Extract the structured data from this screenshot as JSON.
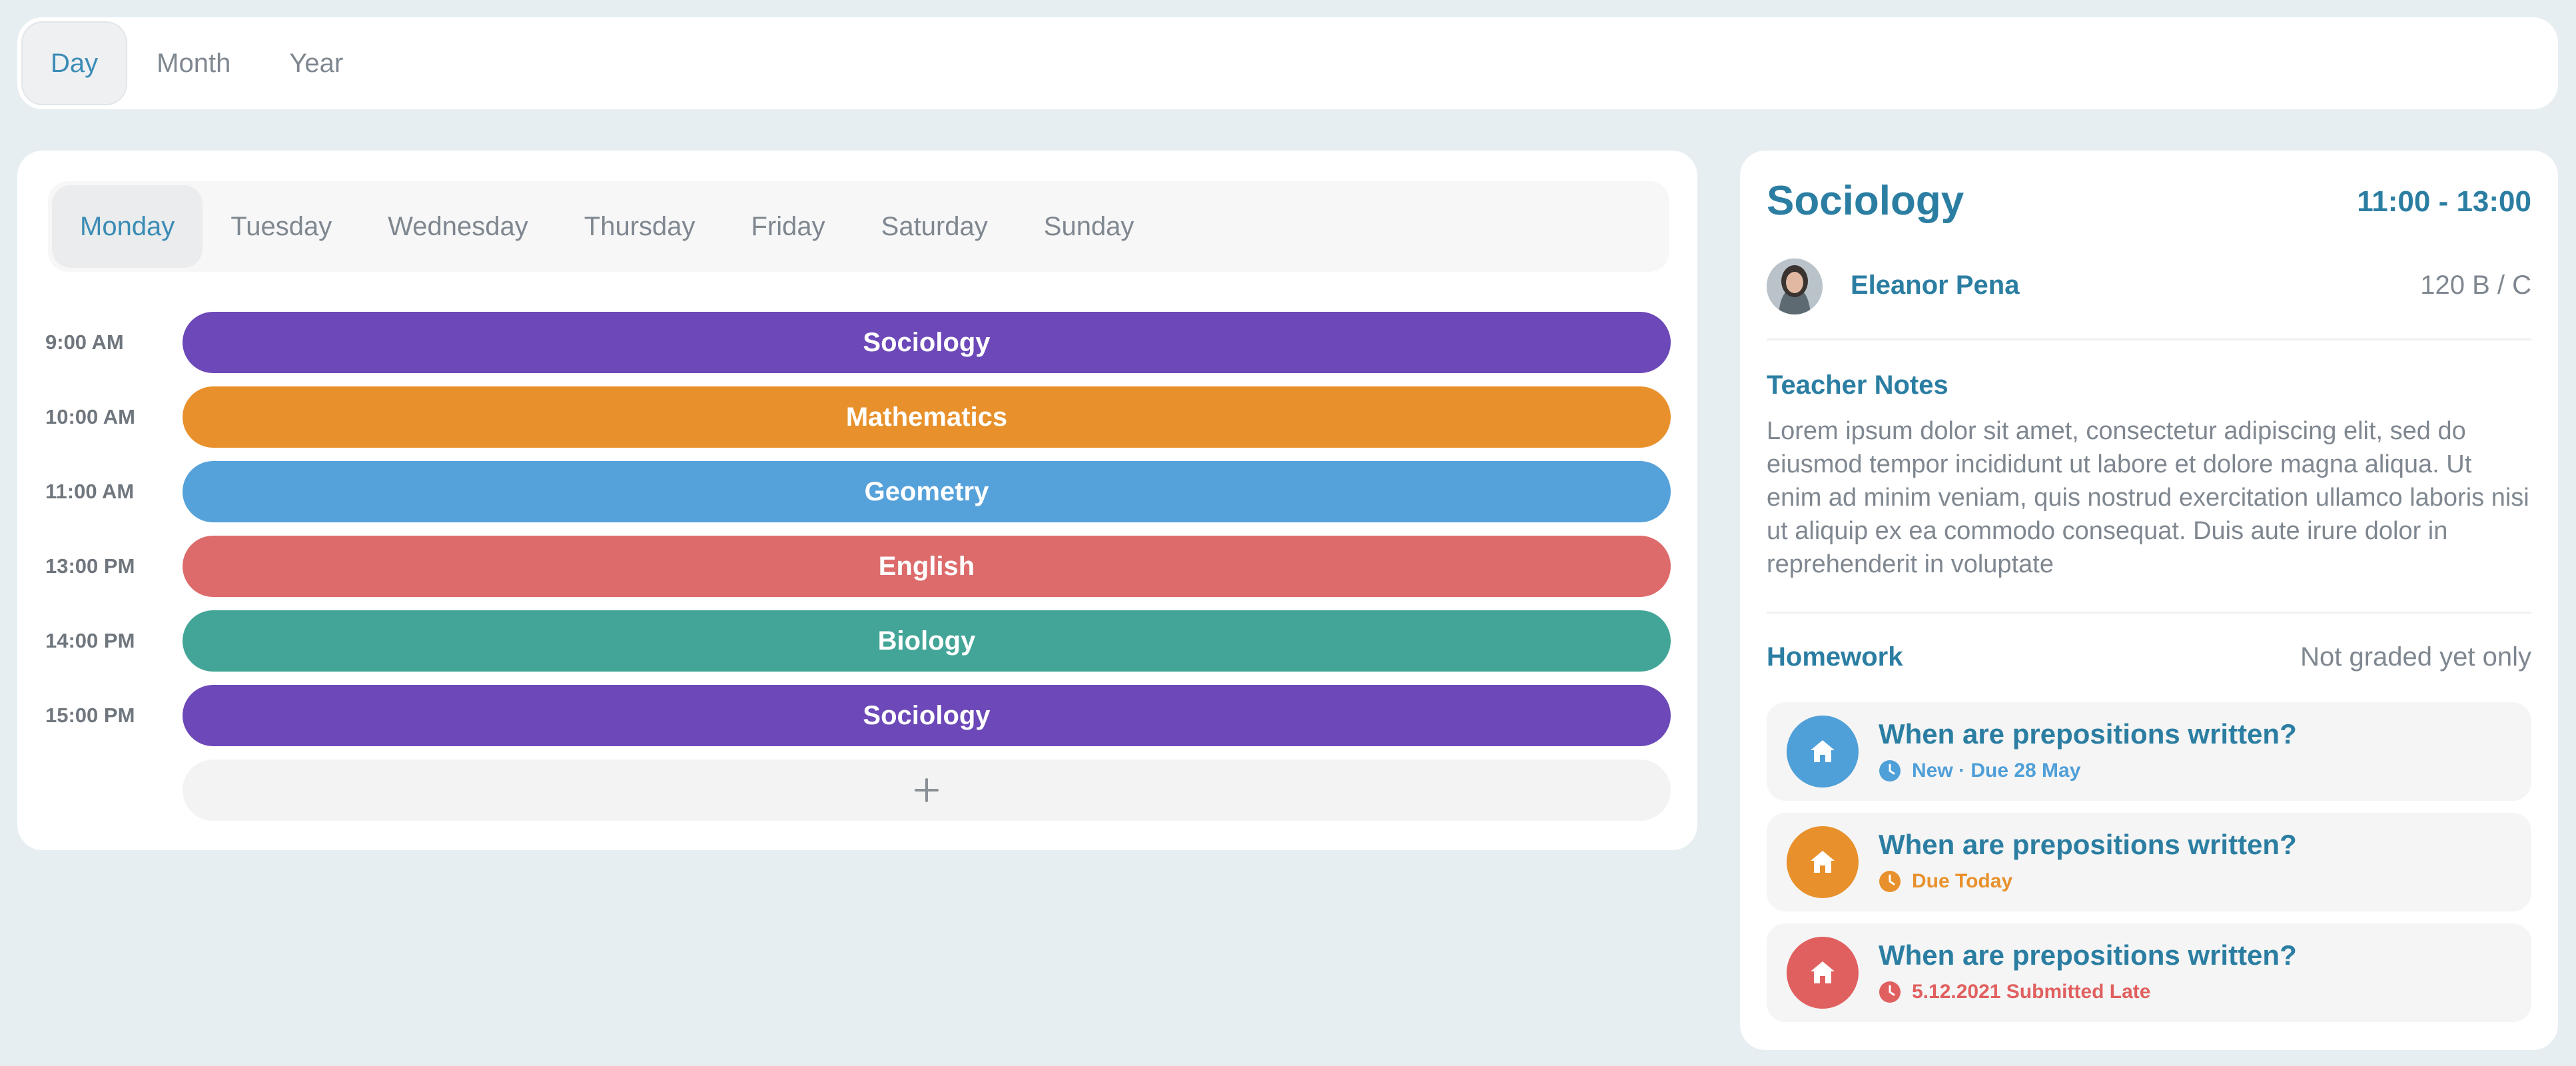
{
  "view_tabs": [
    {
      "label": "Day",
      "active": true
    },
    {
      "label": "Month",
      "active": false
    },
    {
      "label": "Year",
      "active": false
    }
  ],
  "days": [
    {
      "label": "Monday",
      "active": true
    },
    {
      "label": "Tuesday",
      "active": false
    },
    {
      "label": "Wednesday",
      "active": false
    },
    {
      "label": "Thursday",
      "active": false
    },
    {
      "label": "Friday",
      "active": false
    },
    {
      "label": "Saturday",
      "active": false
    },
    {
      "label": "Sunday",
      "active": false
    }
  ],
  "lessons": [
    {
      "time": "9:00 AM",
      "subject": "Sociology",
      "color": "#6c48b8"
    },
    {
      "time": "10:00 AM",
      "subject": "Mathematics",
      "color": "#e8912c"
    },
    {
      "time": "11:00 AM",
      "subject": "Geometry",
      "color": "#55a1da"
    },
    {
      "time": "13:00 PM",
      "subject": "English",
      "color": "#dd6b6b"
    },
    {
      "time": "14:00 PM",
      "subject": "Biology",
      "color": "#42a597"
    },
    {
      "time": "15:00 PM",
      "subject": "Sociology",
      "color": "#6c48b8"
    }
  ],
  "add_icon": "plus-icon",
  "detail": {
    "title": "Sociology",
    "time": "11:00 - 13:00",
    "teacher": "Eleanor Pena",
    "room": "120 B / C",
    "notes_heading": "Teacher Notes",
    "notes": "Lorem ipsum dolor sit amet, consectetur adipiscing elit, sed do eiusmod tempor incididunt ut labore et dolore magna aliqua. Ut enim ad minim veniam, quis nostrud exercitation ullamco laboris nisi ut aliquip ex ea commodo consequat. Duis aute irure dolor in reprehenderit in voluptate",
    "homework_heading": "Homework",
    "homework_filter": "Not graded yet only"
  },
  "homework": [
    {
      "title": "When are prepositions written?",
      "status": "New · Due 28 May",
      "color": "#4f9fd8",
      "icon": "home-icon"
    },
    {
      "title": "When are prepositions written?",
      "status": "Due Today",
      "color": "#e8912c",
      "icon": "home-icon"
    },
    {
      "title": "When are prepositions written?",
      "status": "5.12.2021 Submitted Late",
      "color": "#e0605f",
      "icon": "home-icon"
    }
  ]
}
